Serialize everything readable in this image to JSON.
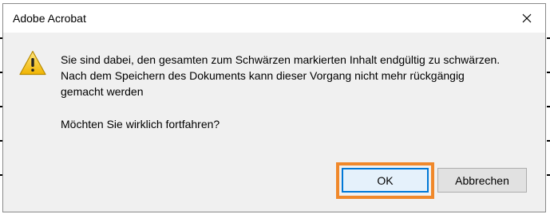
{
  "window": {
    "title": "Adobe Acrobat",
    "close_icon": "close-icon"
  },
  "message": {
    "icon": "warning-icon",
    "line1": "Sie sind dabei, den gesamten zum Schwärzen markierten Inhalt endgültig zu schwärzen.",
    "line2": "Nach dem Speichern des Dokuments kann dieser Vorgang nicht mehr rückgängig",
    "line3": "gemacht werden",
    "question": "Möchten Sie wirklich fortfahren?"
  },
  "buttons": {
    "ok_label": "OK",
    "cancel_label": "Abbrechen"
  },
  "colors": {
    "highlight": "#f0882a",
    "focus_border": "#0078d7",
    "dialog_bg": "#f0f0f0"
  }
}
